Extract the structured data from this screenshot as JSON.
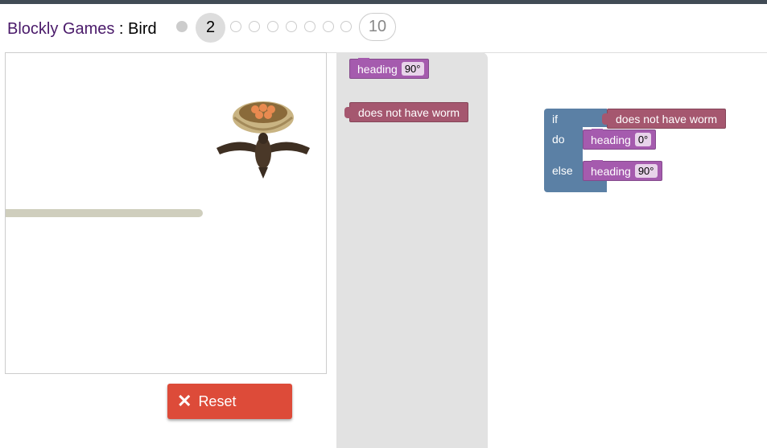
{
  "header": {
    "app_name": "Blockly Games",
    "separator": " : ",
    "game_name": "Bird",
    "current_level": "2",
    "last_level": "10"
  },
  "buttons": {
    "reset_label": "Reset",
    "reset_icon": "close-icon"
  },
  "toolbox": {
    "heading_block": {
      "label": "heading",
      "value": "90°"
    },
    "condition_block": {
      "label": "does not have worm"
    }
  },
  "workspace": {
    "if_block": {
      "if_label": "if",
      "do_label": "do",
      "else_label": "else"
    },
    "condition": {
      "label": "does not have worm"
    },
    "do_heading": {
      "label": "heading",
      "value": "0°"
    },
    "else_heading": {
      "label": "heading",
      "value": "90°"
    }
  },
  "colors": {
    "topbar": "#414b55",
    "reset": "#dd4b39",
    "heading_block": "#a55bae",
    "condition_block": "#a5576f",
    "logic_block": "#5b80a5",
    "flyout": "#e2e2e2",
    "wall": "#cfcebd"
  }
}
